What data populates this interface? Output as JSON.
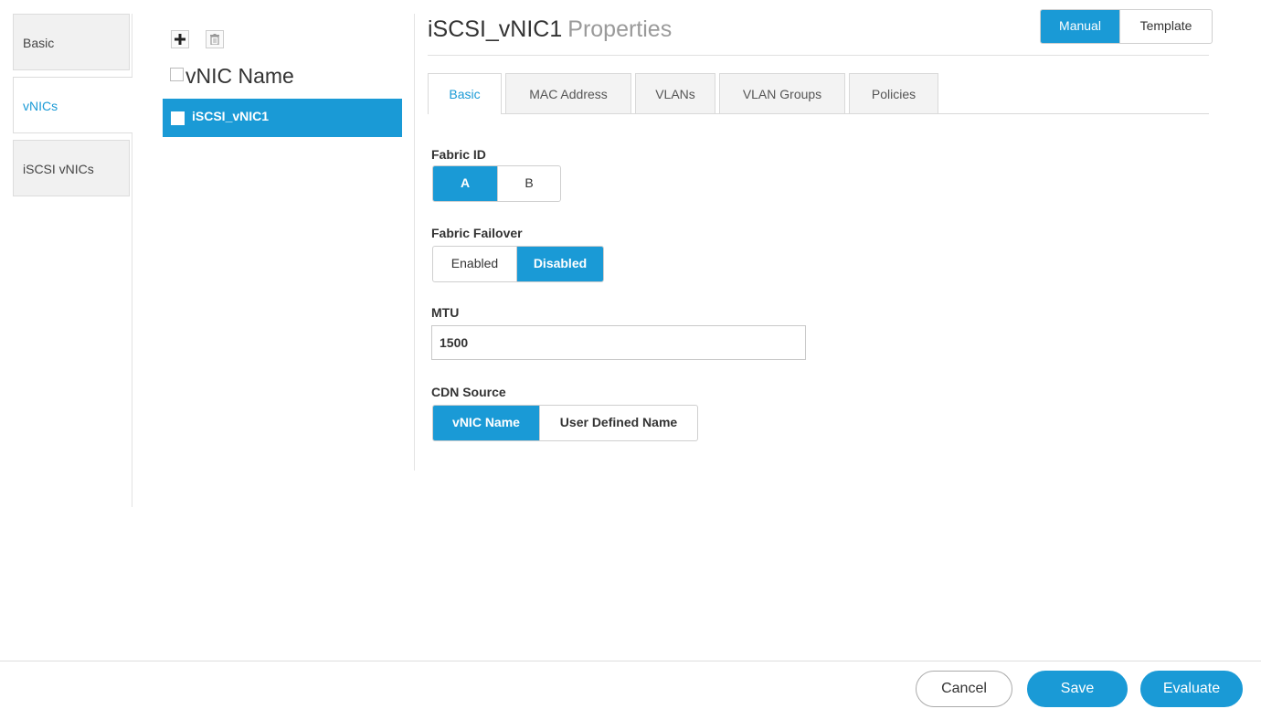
{
  "left_nav": {
    "items": [
      {
        "label": "Basic"
      },
      {
        "label": "vNICs"
      },
      {
        "label": "iSCSI vNICs"
      }
    ]
  },
  "list": {
    "header": "vNIC Name",
    "rows": [
      {
        "name": "iSCSI_vNIC1"
      }
    ]
  },
  "properties": {
    "name": "iSCSI_vNIC1",
    "suffix": "Properties",
    "mode": {
      "options": [
        "Manual",
        "Template"
      ],
      "selected": "Manual"
    },
    "tabs": [
      "Basic",
      "MAC Address",
      "VLANs",
      "VLAN Groups",
      "Policies"
    ],
    "active_tab": "Basic",
    "fabric_id": {
      "label": "Fabric ID",
      "options": [
        "A",
        "B"
      ],
      "selected": "A"
    },
    "fabric_failover": {
      "label": "Fabric Failover",
      "options": [
        "Enabled",
        "Disabled"
      ],
      "selected": "Disabled"
    },
    "mtu": {
      "label": "MTU",
      "value": "1500"
    },
    "cdn_source": {
      "label": "CDN Source",
      "options": [
        "vNIC Name",
        "User Defined Name"
      ],
      "selected": "vNIC Name"
    }
  },
  "footer": {
    "cancel": "Cancel",
    "save": "Save",
    "evaluate": "Evaluate"
  },
  "colors": {
    "accent": "#1a9ad6"
  }
}
